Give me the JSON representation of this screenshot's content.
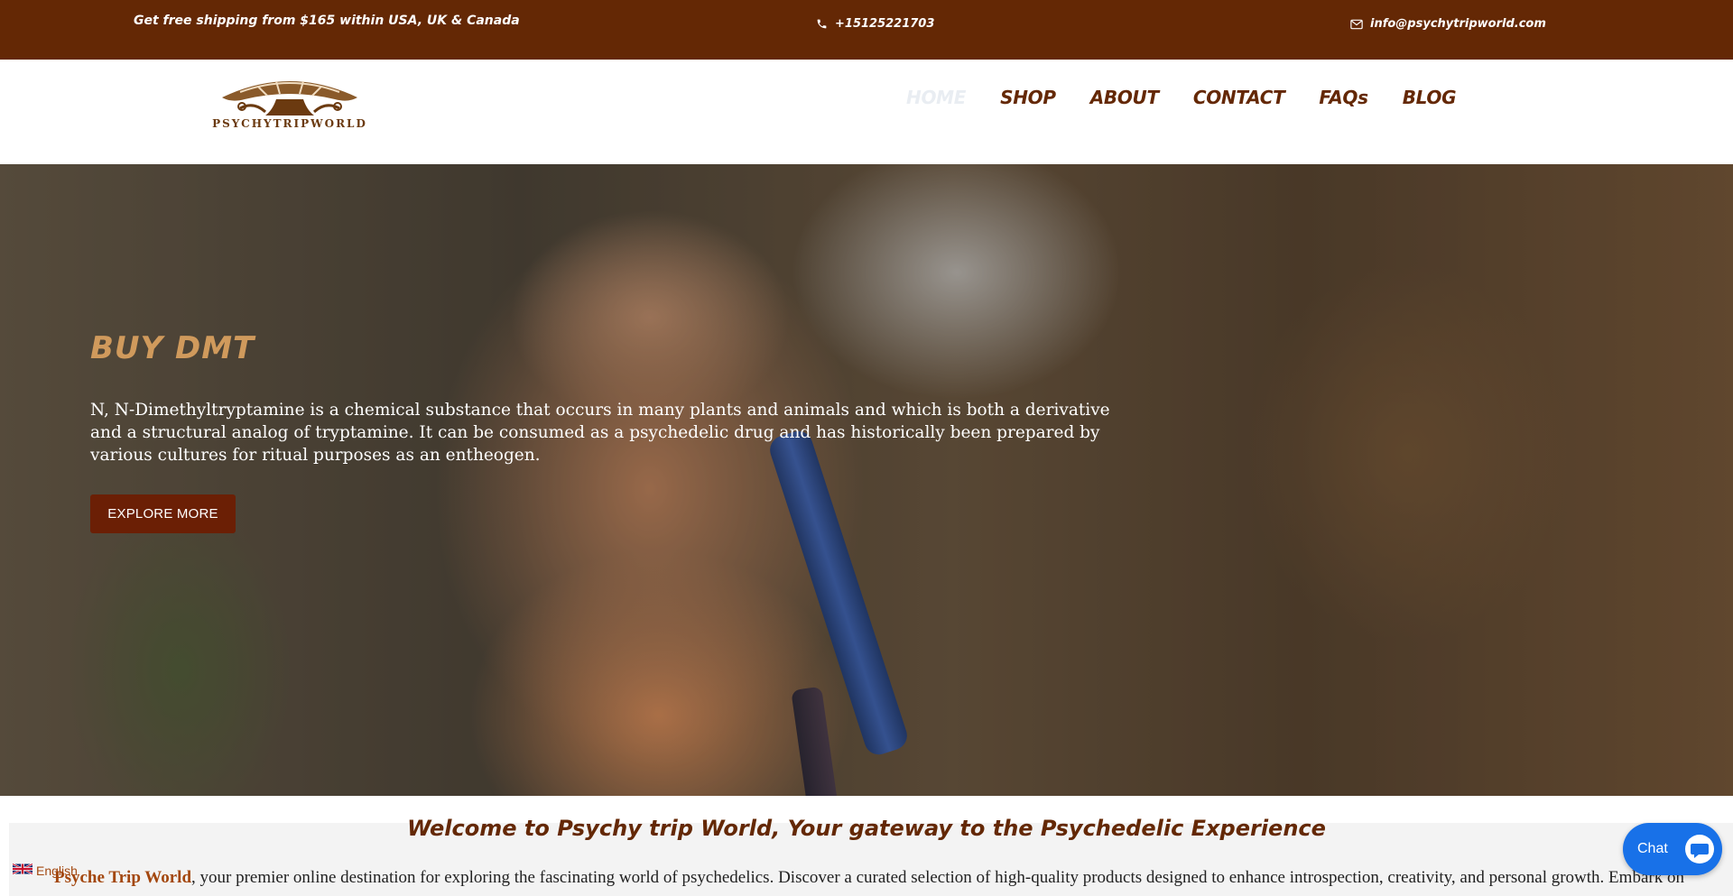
{
  "topbar": {
    "shipping": "Get free shipping from $165 within USA, UK & Canada",
    "phone": "+15125221703",
    "email": "info@psychytripworld.com",
    "bg_color": "#642805"
  },
  "header": {
    "logo_text": "PSYCHYTRIPWORLD",
    "nav": [
      {
        "label": "HOME",
        "active": true
      },
      {
        "label": "SHOP"
      },
      {
        "label": "ABOUT"
      },
      {
        "label": "CONTACT"
      },
      {
        "label": "FAQs"
      },
      {
        "label": "BLOG"
      }
    ]
  },
  "hero": {
    "title": "BUY DMT",
    "description": "N, N-Dimethyltryptamine is a chemical substance that occurs in many plants and animals and which is both a derivative and a structural analog of tryptamine. It can be consumed as a psychedelic drug and has historically been prepared by various cultures for ritual purposes as an entheogen.",
    "button_label": "EXPLORE MORE",
    "title_color": "#d09a5c",
    "button_color": "#6b1f05"
  },
  "welcome": {
    "title": "Welcome to Psychy trip World, Your gateway to the Psychedelic Experience",
    "brand": "Psyche Trip World",
    "text": ", your premier online destination for exploring the fascinating world of psychedelics. Discover a curated selection of high-quality products designed to enhance introspection, creativity, and personal growth. Embark on a journey of"
  },
  "language": {
    "label": "English"
  },
  "chat": {
    "label": "Chat",
    "color": "#1871e8"
  }
}
